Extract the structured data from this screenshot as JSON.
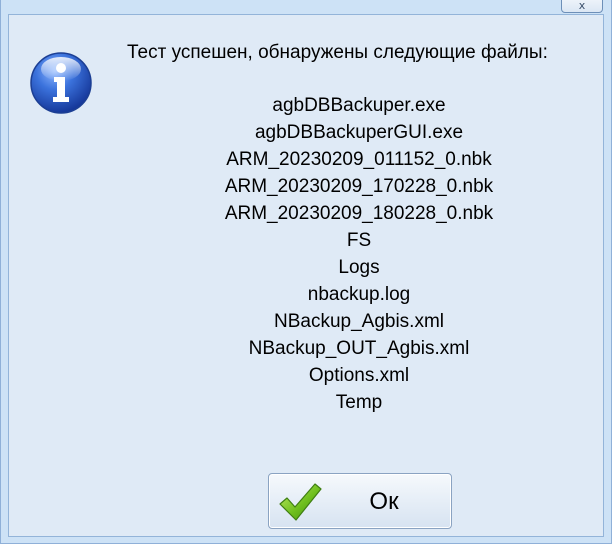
{
  "window": {
    "close_label": "x"
  },
  "dialog": {
    "message": "Тест успешен, обнаружены следующие файлы:",
    "icon": "info-icon",
    "files": [
      "agbDBBackuper.exe",
      "agbDBBackuperGUI.exe",
      "ARM_20230209_011152_0.nbk",
      "ARM_20230209_170228_0.nbk",
      "ARM_20230209_180228_0.nbk",
      "FS",
      "Logs",
      "nbackup.log",
      "NBackup_Agbis.xml",
      "NBackup_OUT_Agbis.xml",
      "Options.xml",
      "Temp"
    ],
    "ok_label": "Ок",
    "ok_icon": "checkmark-icon"
  },
  "colors": {
    "window_bg": "#cde2f6",
    "client_bg": "#dfeaf6",
    "border": "#93b4d9",
    "info_blue": "#2b5fc4",
    "check_green": "#6fbf1e"
  }
}
